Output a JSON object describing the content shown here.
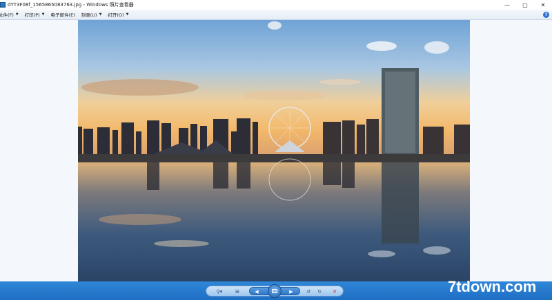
{
  "window": {
    "title": "dYT3F08f_1565865083763.jpg - Windows 照片查看器",
    "icon": "photo-viewer-icon",
    "controls": [
      "minimize",
      "maximize",
      "close"
    ]
  },
  "menu": {
    "items": [
      {
        "label": "文件(F)"
      },
      {
        "label": "打印(P)"
      },
      {
        "label": "电子邮件(E)"
      },
      {
        "label": "刻录(U)"
      },
      {
        "label": "打开(O)"
      }
    ],
    "help_label": "?"
  },
  "viewer": {
    "background": "#f4f7fc",
    "image_description_icon": "photo"
  },
  "controls": {
    "buttons": [
      "zoom-icon",
      "fit-icon",
      "previous-icon",
      "slideshow-icon",
      "next-icon",
      "rotate-left-icon",
      "rotate-right-icon",
      "delete-icon"
    ],
    "bar_color": "#2177cc"
  },
  "watermark": {
    "text": "7tdown.com"
  }
}
